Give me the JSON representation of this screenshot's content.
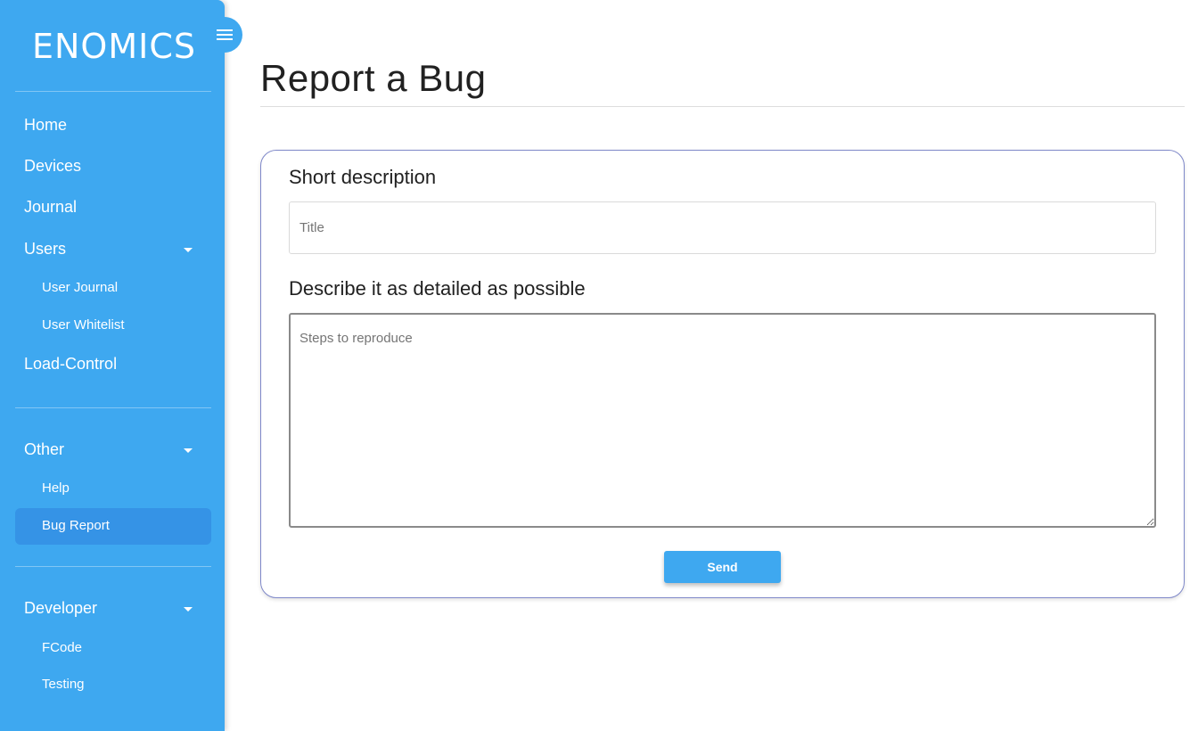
{
  "sidebar": {
    "logo": "ENOMICS",
    "menu_toggle_icon": "hamburger-icon",
    "items": {
      "home": "Home",
      "devices": "Devices",
      "journal": "Journal",
      "users": "Users",
      "user_journal": "User Journal",
      "user_whitelist": "User Whitelist",
      "load_control": "Load-Control",
      "other": "Other",
      "help": "Help",
      "bug_report": "Bug Report",
      "developer": "Developer",
      "fcode": "FCode",
      "testing": "Testing"
    },
    "active_item": "Bug Report",
    "colors": {
      "background": "#3ea8f0",
      "active_background": "#3593e6"
    }
  },
  "main": {
    "title": "Report a Bug",
    "form": {
      "short_description_label": "Short description",
      "title_placeholder": "Title",
      "title_value": "",
      "details_label": "Describe it as detailed as possible",
      "steps_placeholder": "Steps to reproduce",
      "steps_value": "",
      "send_label": "Send"
    }
  }
}
